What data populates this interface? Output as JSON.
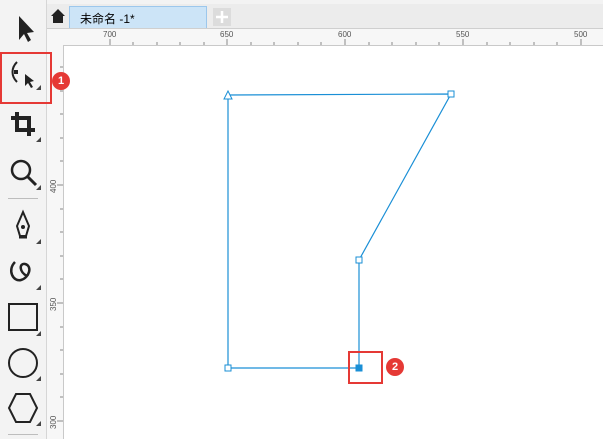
{
  "document": {
    "tab_title": "未命名 -1*"
  },
  "tab_bar": {
    "home_icon": "home-icon",
    "add_tab_icon": "plus-icon"
  },
  "toolbox": {
    "tools": [
      {
        "name": "pick-tool",
        "icon": "arrow-pointer-icon"
      },
      {
        "name": "shape-tool",
        "icon": "node-edit-icon",
        "highlighted": true,
        "badge": "1"
      },
      {
        "name": "crop-tool",
        "icon": "crop-icon"
      },
      {
        "name": "zoom-tool",
        "icon": "magnifier-icon"
      },
      {
        "name": "pen-tool",
        "icon": "pen-nib-icon"
      },
      {
        "name": "freehand-tool",
        "icon": "curve-icon"
      },
      {
        "name": "rectangle-tool",
        "icon": "rectangle-icon"
      },
      {
        "name": "ellipse-tool",
        "icon": "ellipse-icon"
      },
      {
        "name": "polygon-tool",
        "icon": "hexagon-icon"
      }
    ]
  },
  "rulers": {
    "horizontal_labels": [
      "700",
      "650",
      "600",
      "550",
      "500"
    ],
    "vertical_labels": [
      "400",
      "350",
      "300"
    ]
  },
  "annotations": {
    "badge_1": "1",
    "badge_2": "2"
  },
  "colors": {
    "path_stroke": "#1a8fd6",
    "highlight": "#e53935",
    "tab_active": "#cce4f7"
  }
}
